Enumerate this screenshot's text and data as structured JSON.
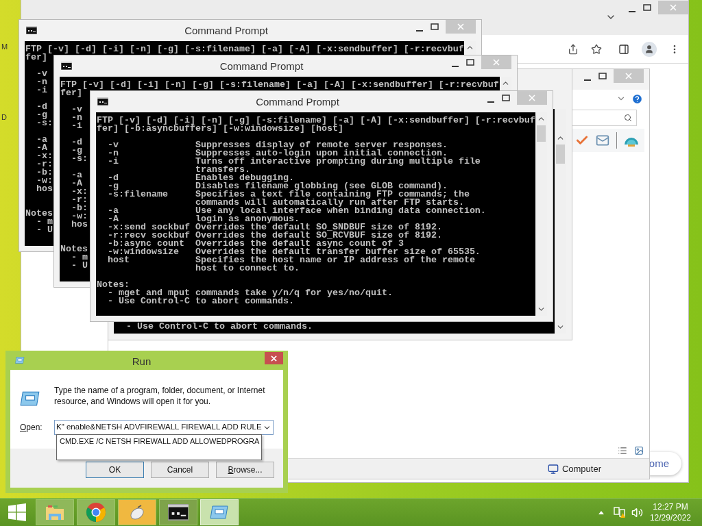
{
  "desktop": {
    "edge_labels": [
      "M",
      "D"
    ]
  },
  "browser": {
    "side_button": "ome"
  },
  "explorer": {
    "status_bar": {
      "location": "Computer"
    }
  },
  "background_console": {
    "lines": [
      "  - Use Control-C to abort commands."
    ]
  },
  "command_windows": [
    {
      "title": "Command Prompt",
      "active": false,
      "lines": [
        {
          "kind": "text",
          "text": "FTP [-v] [-d] [-i] [-n] [-g] [-s:filename] [-a] [-A] [-x:sendbuffer] [-r:recvbuf"
        },
        {
          "kind": "text",
          "text": "fer]"
        },
        {
          "kind": "blank"
        },
        {
          "kind": "text",
          "text": "  -v"
        },
        {
          "kind": "text",
          "text": "  -n"
        },
        {
          "kind": "text",
          "text": "  -i"
        },
        {
          "kind": "blank"
        },
        {
          "kind": "text",
          "text": "  -d"
        },
        {
          "kind": "text",
          "text": "  -g"
        },
        {
          "kind": "text",
          "text": "  -s:"
        },
        {
          "kind": "blank"
        },
        {
          "kind": "text",
          "text": "  -a"
        },
        {
          "kind": "text",
          "text": "  -A"
        },
        {
          "kind": "text",
          "text": "  -x:"
        },
        {
          "kind": "text",
          "text": "  -r:"
        },
        {
          "kind": "text",
          "text": "  -b:"
        },
        {
          "kind": "text",
          "text": "  -w:"
        },
        {
          "kind": "text",
          "text": "  hos"
        },
        {
          "kind": "blank"
        },
        {
          "kind": "blank"
        },
        {
          "kind": "text",
          "text": "Notes"
        },
        {
          "kind": "text",
          "text": "  - m"
        },
        {
          "kind": "text",
          "text": "  - U"
        }
      ]
    },
    {
      "title": "Command Prompt",
      "active": false,
      "lines": [
        {
          "kind": "text",
          "text": "FTP [-v] [-d] [-i] [-n] [-g] [-s:filename] [-a] [-A] [-x:sendbuffer] [-r:recvbuf"
        },
        {
          "kind": "text",
          "text": "fer]"
        },
        {
          "kind": "blank"
        },
        {
          "kind": "text",
          "text": "  -v"
        },
        {
          "kind": "text",
          "text": "  -n"
        },
        {
          "kind": "text",
          "text": "  -i"
        },
        {
          "kind": "blank"
        },
        {
          "kind": "text",
          "text": "  -d"
        },
        {
          "kind": "text",
          "text": "  -g"
        },
        {
          "kind": "text",
          "text": "  -s:"
        },
        {
          "kind": "blank"
        },
        {
          "kind": "text",
          "text": "  -a"
        },
        {
          "kind": "text",
          "text": "  -A"
        },
        {
          "kind": "text",
          "text": "  -x:"
        },
        {
          "kind": "text",
          "text": "  -r:"
        },
        {
          "kind": "text",
          "text": "  -b:"
        },
        {
          "kind": "text",
          "text": "  -w:"
        },
        {
          "kind": "text",
          "text": "  hos"
        },
        {
          "kind": "blank"
        },
        {
          "kind": "blank"
        },
        {
          "kind": "text",
          "text": "Notes"
        },
        {
          "kind": "text",
          "text": "  - m"
        },
        {
          "kind": "text",
          "text": "  - U"
        }
      ]
    },
    {
      "title": "Command Prompt",
      "active": false,
      "lines": [
        {
          "kind": "text",
          "text": "FTP [-v] [-d] [-i] [-n] [-g] [-s:filename] [-a] [-A] [-x:sendbuffer] [-r:recvbuf"
        },
        {
          "kind": "text",
          "text": "fer] [-b:asyncbuffers] [-w:windowsize] [host]"
        },
        {
          "kind": "blank"
        },
        {
          "kind": "text",
          "text": "  -v              Suppresses display of remote server responses."
        },
        {
          "kind": "text",
          "text": "  -n              Suppresses auto-login upon initial connection."
        },
        {
          "kind": "text",
          "text": "  -i              Turns off interactive prompting during multiple file"
        },
        {
          "kind": "text",
          "text": "                  transfers."
        },
        {
          "kind": "text",
          "text": "  -d              Enables debugging."
        },
        {
          "kind": "text",
          "text": "  -g              Disables filename globbing (see GLOB command)."
        },
        {
          "kind": "text",
          "text": "  -s:filename     Specifies a text file containing FTP commands; the"
        },
        {
          "kind": "text",
          "text": "                  commands will automatically run after FTP starts."
        },
        {
          "kind": "text",
          "text": "  -a              Use any local interface when binding data connection."
        },
        {
          "kind": "text",
          "text": "  -A              login as anonymous."
        },
        {
          "kind": "text",
          "text": "  -x:send sockbuf Overrides the default SO_SNDBUF size of 8192."
        },
        {
          "kind": "text",
          "text": "  -r:recv sockbuf Overrides the default SO_RCVBUF size of 8192."
        },
        {
          "kind": "text",
          "text": "  -b:async count  Overrides the default async count of 3"
        },
        {
          "kind": "text",
          "text": "  -w:windowsize   Overrides the default transfer buffer size of 65535."
        },
        {
          "kind": "text",
          "text": "  host            Specifies the host name or IP address of the remote"
        },
        {
          "kind": "text",
          "text": "                  host to connect to."
        },
        {
          "kind": "blank"
        },
        {
          "kind": "text",
          "text": "Notes:"
        },
        {
          "kind": "text",
          "text": "  - mget and mput commands take y/n/q for yes/no/quit."
        },
        {
          "kind": "text",
          "text": "  - Use Control-C to abort commands."
        }
      ]
    }
  ],
  "run_dialog": {
    "title": "Run",
    "active": true,
    "description": "Type the name of a program, folder, document, or Internet resource, and Windows will open it for you.",
    "open_label": "Open:",
    "open_mnemonic": true,
    "open_value": "K\" enable&NETSH ADVFIREWALL FIREWALL ADD RULE",
    "suggestions": [
      "CMD.EXE /C NETSH FIREWALL ADD ALLOWEDPROGRA"
    ],
    "buttons": [
      {
        "label": "OK",
        "default": true,
        "mnemonic": false
      },
      {
        "label": "Cancel",
        "default": false,
        "mnemonic": false
      },
      {
        "label": "Browse...",
        "default": false,
        "mnemonic": true
      }
    ]
  },
  "taskbar": {
    "apps": [
      {
        "kind": "explorer",
        "selected": false
      },
      {
        "kind": "browser",
        "selected": false
      },
      {
        "kind": "mouse",
        "selected": false
      },
      {
        "kind": "console",
        "selected": false
      },
      {
        "kind": "run",
        "selected": true
      }
    ],
    "clock": {
      "time": "12:27 PM",
      "date": "12/29/2022"
    }
  }
}
